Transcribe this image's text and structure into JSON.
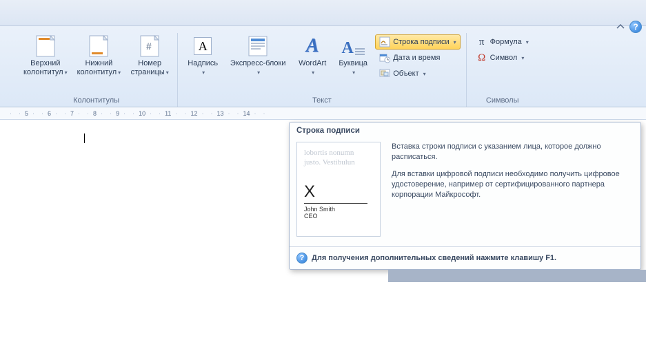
{
  "titlebar": {
    "collapse_icon": "collapse",
    "help_icon": "?"
  },
  "ribbon": {
    "groups": {
      "headers_footers": {
        "label": "Колонтитулы",
        "header_btn": {
          "line1": "Верхний",
          "line2": "колонтитул"
        },
        "footer_btn": {
          "line1": "Нижний",
          "line2": "колонтитул"
        },
        "pagenum_btn": {
          "line1": "Номер",
          "line2": "страницы"
        }
      },
      "text": {
        "label": "Текст",
        "textbox": "Надпись",
        "express": "Экспресс-блоки",
        "wordart": "WordArt",
        "dropcap": "Буквица",
        "signature_line": "Строка подписи",
        "date_time": "Дата и время",
        "object": "Объект"
      },
      "symbols": {
        "label": "Символы",
        "formula": "Формула",
        "symbol": "Символ"
      }
    }
  },
  "ruler": {
    "marks": [
      "5",
      "6",
      "7",
      "8",
      "9",
      "10",
      "11",
      "12",
      "13",
      "14"
    ]
  },
  "supertip": {
    "title": "Строка подписи",
    "preview": {
      "lorem1": "lobortis  nonumn",
      "lorem2": "justo. Vestibulun",
      "sig_x": "X",
      "sig_name": "John Smith",
      "sig_role": "CEO"
    },
    "para1": "Вставка строки подписи с указанием лица, которое должно расписаться.",
    "para2": "Для вставки цифровой подписи необходимо получить цифровое удостоверение, например от сертифицированного партнера корпорации Майкрософт.",
    "footer": "Для получения дополнительных сведений нажмите клавишу F1."
  }
}
